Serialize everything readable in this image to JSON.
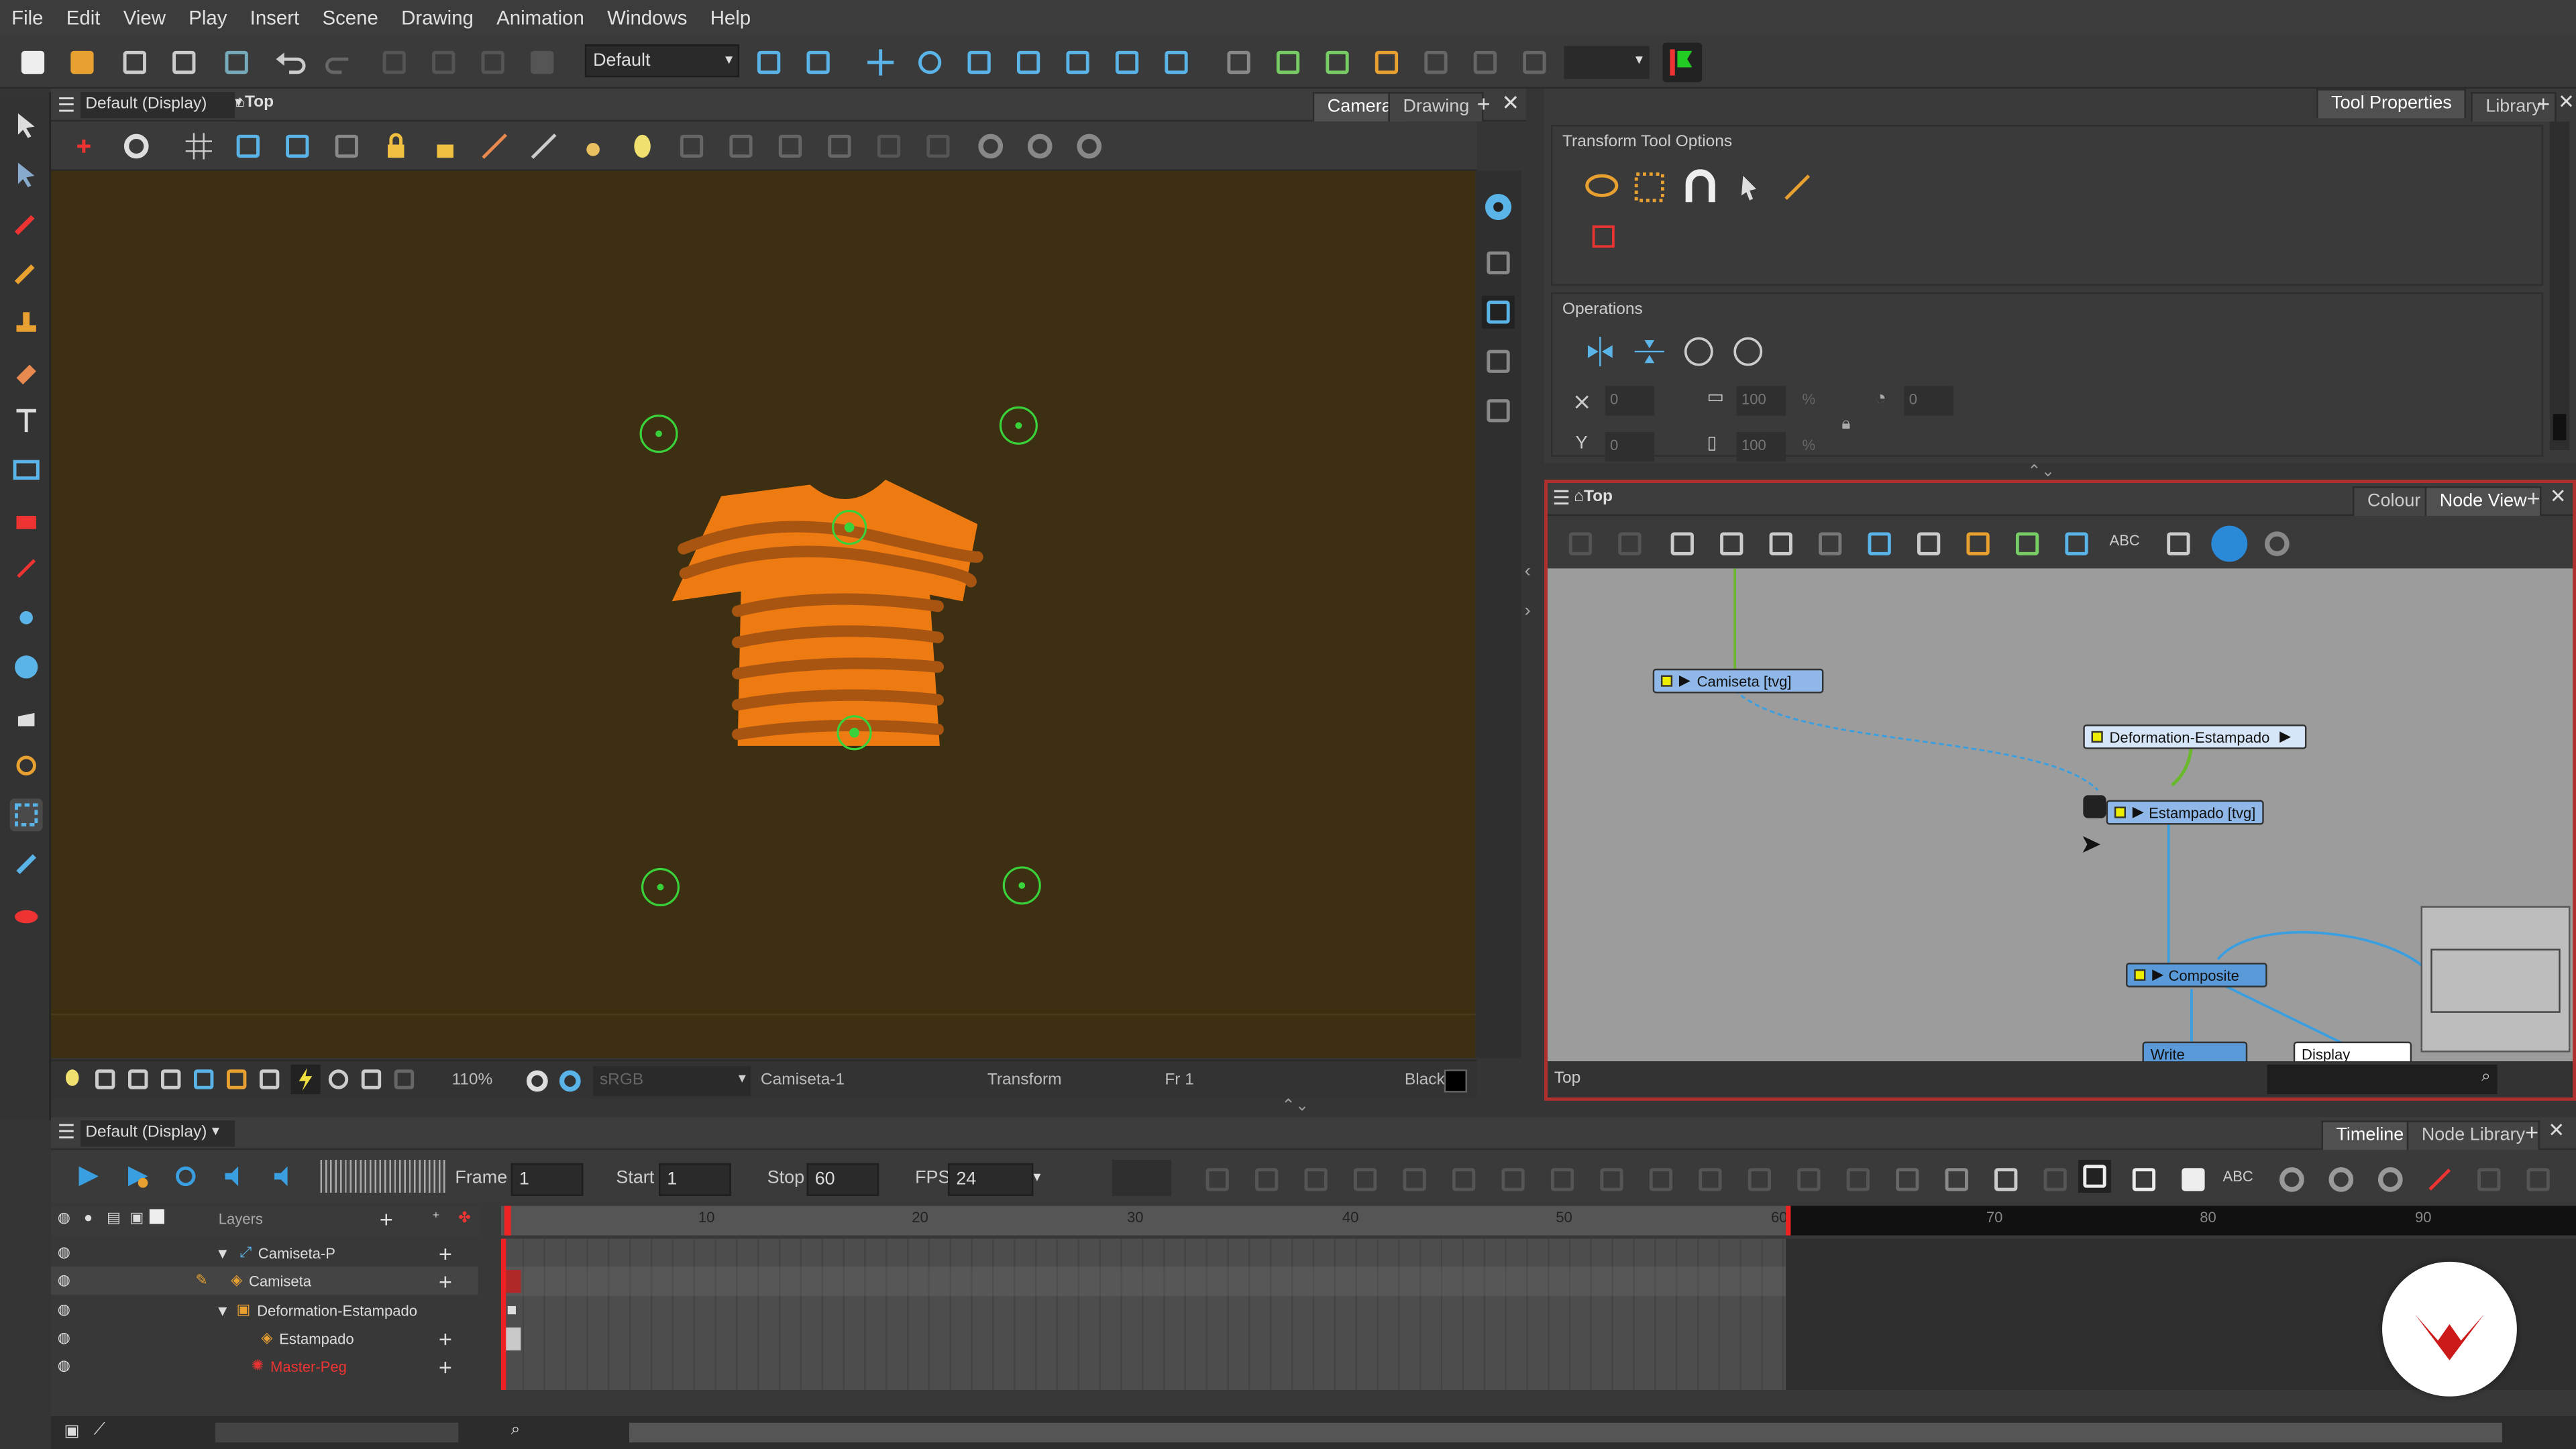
{
  "menu": [
    "File",
    "Edit",
    "View",
    "Play",
    "Insert",
    "Scene",
    "Drawing",
    "Animation",
    "Windows",
    "Help"
  ],
  "toolbar": {
    "workspace": "Default"
  },
  "camera_view": {
    "view_selector": "Default (Display)",
    "breadcrumb": "Top",
    "tabs": [
      "Camera",
      "Drawing"
    ],
    "active_tab": "Camera"
  },
  "status": {
    "zoom": "110%",
    "color_space": "sRGB",
    "drawing_name": "Camiseta-1",
    "tool": "Transform",
    "frame": "Fr 1",
    "bg_color_label": "Black"
  },
  "tool_properties": {
    "tabs": [
      "Tool Properties",
      "Library"
    ],
    "title": "Transform Tool Options",
    "operations_label": "Operations",
    "x": "0",
    "y": "0",
    "w": "100",
    "h": "100",
    "angle": "0",
    "pct1": "%",
    "pct2": "%"
  },
  "node_view": {
    "breadcrumb": "Top",
    "tabs": [
      "Colour",
      "Node View"
    ],
    "footer": "Top",
    "nodes": {
      "camiseta": "Camiseta [tvg]",
      "deformation": "Deformation-Estampado",
      "estampado": "Estampado [tvg]",
      "composite": "Composite",
      "write": "Write",
      "display": "Display"
    }
  },
  "timeline": {
    "view_selector": "Default (Display)",
    "tabs": [
      "Timeline",
      "Node Library"
    ],
    "frame_label": "Frame",
    "frame": "1",
    "start_label": "Start",
    "start": "1",
    "stop_label": "Stop",
    "stop": "60",
    "fps_label": "FPS",
    "fps": "24",
    "layers_label": "Layers",
    "ruler": [
      "10",
      "20",
      "30",
      "40",
      "50",
      "60",
      "70",
      "80",
      "90"
    ],
    "layers": [
      "Camiseta-P",
      "Camiseta",
      "Deformation-Estampado",
      "Estampado",
      "Master-Peg"
    ]
  },
  "colors": {
    "accent": "#e8761a",
    "canvas": "#3d2f12",
    "node_border": "#b03030"
  }
}
